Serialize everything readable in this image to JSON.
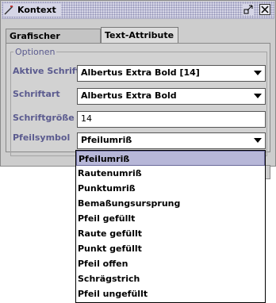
{
  "window": {
    "title": "Kontext"
  },
  "tabs": [
    {
      "label": "Grafischer Kontext",
      "active": false
    },
    {
      "label": "Text-Attribute",
      "active": true
    }
  ],
  "group": {
    "legend": "Optionen"
  },
  "fields": {
    "active_font": {
      "label": "Aktive Schrift",
      "value": "Albertus Extra Bold [14]"
    },
    "font": {
      "label": "Schriftart",
      "value": "Albertus Extra Bold"
    },
    "font_size": {
      "label": "Schriftgröße",
      "value": "14"
    },
    "arrow_symbol": {
      "label": "Pfeilsymbol",
      "value": "Pfeilumriß"
    }
  },
  "dropdown": {
    "selected_index": 0,
    "options": [
      "Pfeilumriß",
      "Rautenumriß",
      "Punktumriß",
      "Bemaßungsursprung",
      "Pfeil gefüllt",
      "Raute gefüllt",
      "Punkt gefüllt",
      "Pfeil offen",
      "Schrägstrich",
      "Pfeil ungefüllt"
    ]
  },
  "colors": {
    "label": "#5b5b8f",
    "selection": "#b7b7d8",
    "titlebar": "#d5d5e6"
  }
}
